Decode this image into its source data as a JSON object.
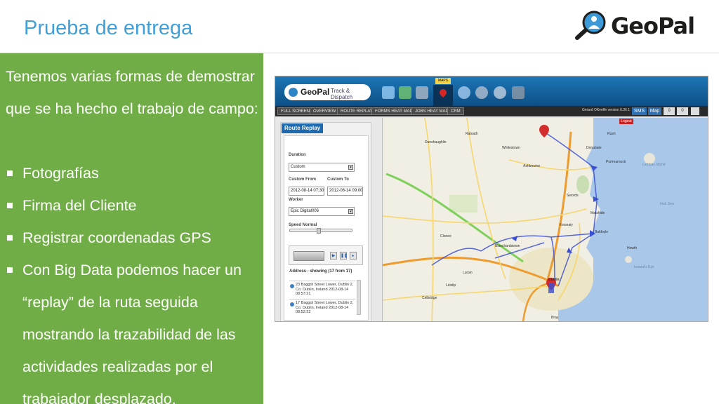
{
  "slide": {
    "title": "Prueba de entrega",
    "logo_text": "GeoPal"
  },
  "content": {
    "intro": "Tenemos varias formas de demostrar que se ha hecho el trabajo de campo:",
    "bullets": [
      "Fotografías",
      "Firma del Cliente",
      "Registrar coordenadas GPS",
      "Con Big Data podemos hacer un “replay” de la ruta seguida mostrando la trazabilidad de las actividades realizadas por el trabajador desplazado."
    ]
  },
  "app": {
    "logo": "GeoPal",
    "tagline": "Track & Dispatch",
    "maps_tab": "MAPS",
    "nav": [
      "FULL SCREEN",
      "OVERVIEW",
      "ROUTE REPLAY",
      "FORMS HEAT MAP",
      "JOBS HEAT MAP",
      "CRM"
    ],
    "user": "Gerard OKeeffe  version 0.36.1",
    "sms": "SMS",
    "map": "Map",
    "count_a": "0",
    "count_b": "0",
    "logout": "Logout",
    "panel_title": "Route Replay",
    "duration_label": "Duration",
    "duration_value": "Custom",
    "from_label": "Custom From",
    "from_value": "2012-08-14 07:30",
    "to_label": "Custom To",
    "to_value": "2012-08-14 09:00",
    "worker_label": "Worker",
    "worker_value": "Epic Digital006",
    "speed_label": "Speed Normal",
    "address_header": "Address - showing (17 from 17)",
    "addresses": [
      "23 Baggot Street Lower, Dublin 2, Co. Dublin, Ireland 2012-08-14 08:57:21",
      "17 Baggot Street Lower, Dublin 2, Co. Dublin, Ireland 2012-08-14 08:52:22"
    ],
    "places": [
      "Dunshaughlin",
      "Ratoath",
      "Ashbourne",
      "Swords",
      "Malahide",
      "Portmarnock",
      "Howth",
      "Clonee",
      "Blanchardstown",
      "Lucan",
      "Dublin",
      "Bray",
      "Celbridge",
      "Leixlip",
      "Kinsealy",
      "Baldoyle",
      "Irish Sea",
      "Lambay Island",
      "Ireland's Eye",
      "Whitestown",
      "Rush",
      "Donabate"
    ]
  },
  "colors": {
    "title": "#3f9fd9",
    "panel_green": "#70ad47",
    "app_blue": "#1d76b6",
    "sea": "#a9c7e8"
  }
}
